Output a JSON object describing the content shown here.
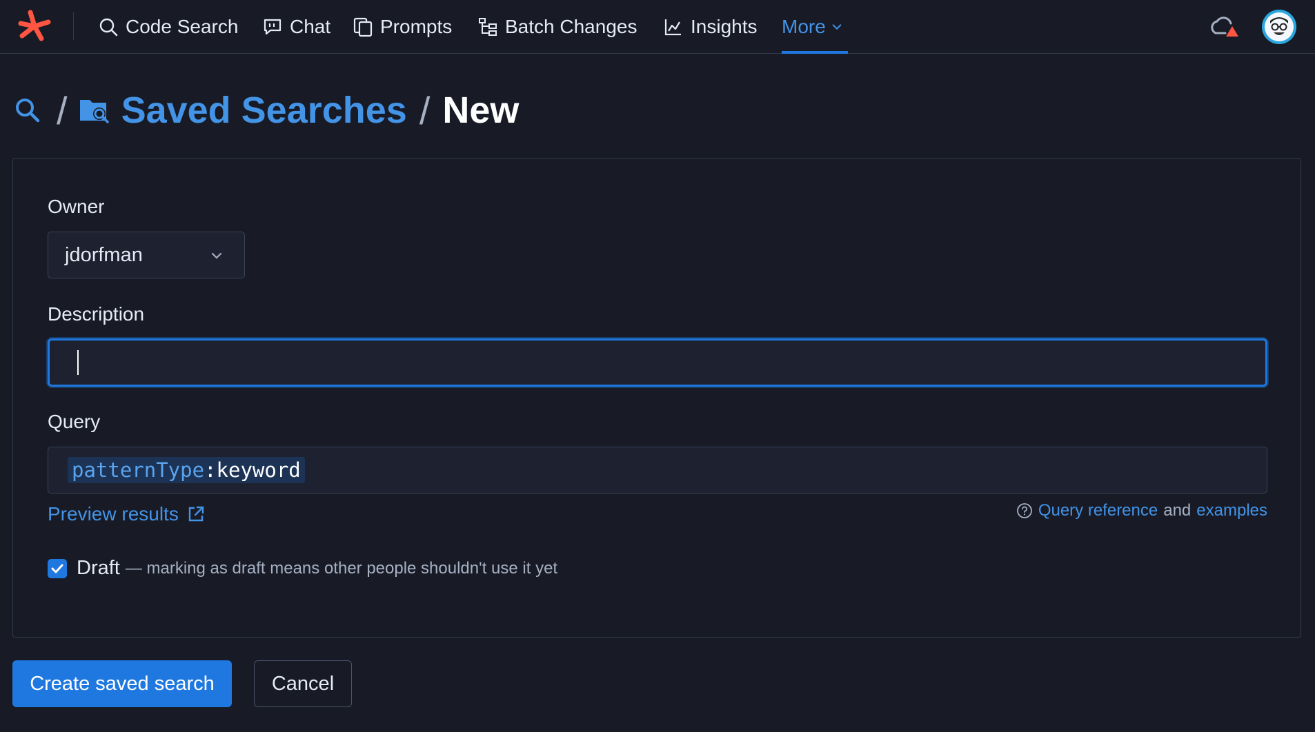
{
  "nav": {
    "items": [
      {
        "label": "Code Search",
        "icon": "search-icon"
      },
      {
        "label": "Chat",
        "icon": "chat-icon"
      },
      {
        "label": "Prompts",
        "icon": "prompts-icon"
      },
      {
        "label": "Batch Changes",
        "icon": "batch-changes-icon"
      },
      {
        "label": "Insights",
        "icon": "insights-icon"
      }
    ],
    "more_label": "More"
  },
  "breadcrumb": {
    "section": "Saved Searches",
    "current": "New"
  },
  "form": {
    "owner_label": "Owner",
    "owner_value": "jdorfman",
    "description_label": "Description",
    "description_value": "",
    "query_label": "Query",
    "query_field": "patternType",
    "query_separator": ":",
    "query_value": "keyword",
    "preview_label": "Preview results",
    "ref_query": "Query reference",
    "ref_and": "and",
    "ref_examples": "examples",
    "draft_label": "Draft",
    "draft_hint": "— marking as draft means other people shouldn't use it yet",
    "draft_checked": true
  },
  "actions": {
    "create_label": "Create saved search",
    "cancel_label": "Cancel"
  },
  "colors": {
    "background": "#181b26",
    "accent": "#1f78e0",
    "link": "#4393e7",
    "logo": "#ff5543"
  }
}
